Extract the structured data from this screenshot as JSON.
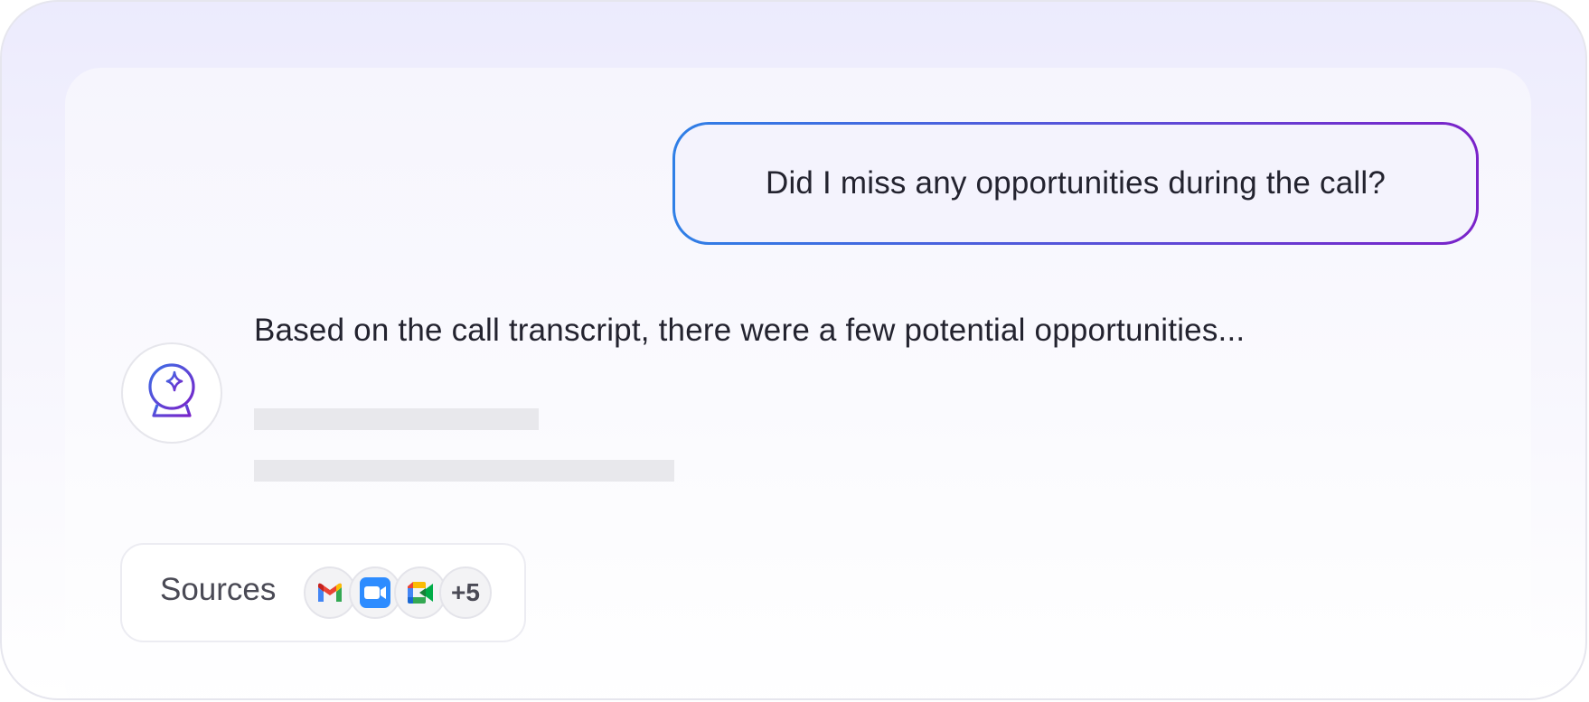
{
  "conversation": {
    "user_message": "Did I miss any opportunities during the call?",
    "assistant_message": "Based on the call transcript, there were a few potential opportunities..."
  },
  "sources": {
    "label": "Sources",
    "icons": [
      "gmail-icon",
      "zoom-icon",
      "google-meet-icon"
    ],
    "more_count": "+5"
  },
  "colors": {
    "accent_blue": "#2f7fe6",
    "accent_purple": "#7a22c9",
    "skeleton": "#e8e8ec"
  }
}
